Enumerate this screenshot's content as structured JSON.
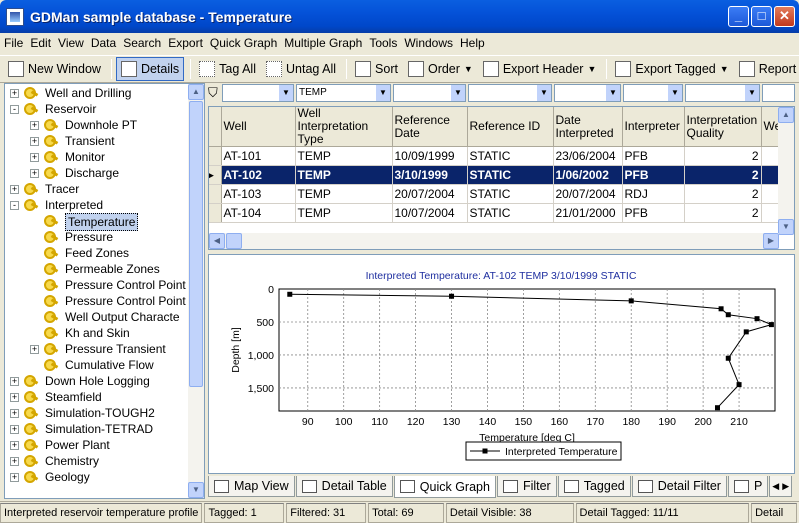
{
  "window": {
    "title": "GDMan sample database - Temperature"
  },
  "menu": [
    "File",
    "Edit",
    "View",
    "Data",
    "Search",
    "Export",
    "Quick Graph",
    "Multiple Graph",
    "Tools",
    "Windows",
    "Help"
  ],
  "toolbar": {
    "new_window": "New Window",
    "details": "Details",
    "tag_all": "Tag All",
    "untag_all": "Untag All",
    "sort": "Sort",
    "order": "Order",
    "export_header": "Export Header",
    "export_tagged": "Export Tagged",
    "report": "Report"
  },
  "tree": [
    {
      "label": "Well and Drilling",
      "level": 0,
      "exp": "+",
      "icon": true
    },
    {
      "label": "Reservoir",
      "level": 0,
      "exp": "-",
      "icon": true
    },
    {
      "label": "Downhole PT",
      "level": 1,
      "exp": "+",
      "icon": true
    },
    {
      "label": "Transient",
      "level": 1,
      "exp": "+",
      "icon": true
    },
    {
      "label": "Monitor",
      "level": 1,
      "exp": "+",
      "icon": true
    },
    {
      "label": "Discharge",
      "level": 1,
      "exp": "+",
      "icon": true
    },
    {
      "label": "Tracer",
      "level": 0,
      "exp": "+",
      "icon": true
    },
    {
      "label": "Interpreted",
      "level": 0,
      "exp": "-",
      "icon": true
    },
    {
      "label": "Temperature",
      "level": 1,
      "exp": "",
      "icon": true,
      "selected": true
    },
    {
      "label": "Pressure",
      "level": 1,
      "exp": "",
      "icon": true
    },
    {
      "label": "Feed Zones",
      "level": 1,
      "exp": "",
      "icon": true
    },
    {
      "label": "Permeable Zones",
      "level": 1,
      "exp": "",
      "icon": true
    },
    {
      "label": "Pressure Control Point",
      "level": 1,
      "exp": "",
      "icon": true
    },
    {
      "label": "Pressure Control Point",
      "level": 1,
      "exp": "",
      "icon": true
    },
    {
      "label": "Well Output Characte",
      "level": 1,
      "exp": "",
      "icon": true
    },
    {
      "label": "Kh and Skin",
      "level": 1,
      "exp": "",
      "icon": true
    },
    {
      "label": "Pressure Transient",
      "level": 1,
      "exp": "+",
      "icon": true
    },
    {
      "label": "Cumulative Flow",
      "level": 1,
      "exp": "",
      "icon": true
    },
    {
      "label": "Down Hole Logging",
      "level": 0,
      "exp": "+",
      "icon": true
    },
    {
      "label": "Steamfield",
      "level": 0,
      "exp": "+",
      "icon": true
    },
    {
      "label": "Simulation-TOUGH2",
      "level": 0,
      "exp": "+",
      "icon": true
    },
    {
      "label": "Simulation-TETRAD",
      "level": 0,
      "exp": "+",
      "icon": true
    },
    {
      "label": "Power Plant",
      "level": 0,
      "exp": "+",
      "icon": true
    },
    {
      "label": "Chemistry",
      "level": 0,
      "exp": "+",
      "icon": true
    },
    {
      "label": "Geology",
      "level": 0,
      "exp": "+",
      "icon": true
    }
  ],
  "filter": {
    "well_type_value": "TEMP"
  },
  "grid": {
    "columns": [
      "Well",
      "Well Interpretation Type",
      "Reference Date",
      "Reference ID",
      "Date Interpreted",
      "Interpreter",
      "Interpretation Quality",
      "We"
    ],
    "rows": [
      [
        "AT-101",
        "TEMP",
        "10/09/1999",
        "STATIC",
        "23/06/2004",
        "PFB",
        "2"
      ],
      [
        "AT-102",
        "TEMP",
        "3/10/1999",
        "STATIC",
        "1/06/2002",
        "PFB",
        "2"
      ],
      [
        "AT-103",
        "TEMP",
        "20/07/2004",
        "STATIC",
        "20/07/2004",
        "RDJ",
        "2"
      ],
      [
        "AT-104",
        "TEMP",
        "10/07/2004",
        "STATIC",
        "21/01/2000",
        "PFB",
        "2"
      ]
    ],
    "selected_row": 1
  },
  "chart_data": {
    "type": "line",
    "title": "Interpreted Temperature:   AT-102 TEMP 3/10/1999 STATIC",
    "xlabel": "Temperature [deg C]",
    "ylabel": "Depth [m]",
    "xlim": [
      82,
      220
    ],
    "ylim": [
      0,
      1850
    ],
    "xticks": [
      90,
      100,
      110,
      120,
      130,
      140,
      150,
      160,
      170,
      180,
      190,
      200,
      210
    ],
    "yticks": [
      0,
      500,
      1000,
      1500
    ],
    "ytick_labels": [
      "0",
      "500",
      "1,000",
      "1,500"
    ],
    "grid": true,
    "legend": "bottom",
    "series": [
      {
        "name": "Interpreted Temperature",
        "x": [
          85,
          130,
          180,
          205,
          207,
          215,
          219,
          212,
          207,
          210,
          204
        ],
        "y": [
          80,
          110,
          180,
          300,
          390,
          450,
          540,
          650,
          1050,
          1450,
          1800
        ]
      }
    ]
  },
  "tabs": [
    {
      "label": "Map View",
      "active": false
    },
    {
      "label": "Detail Table",
      "active": false
    },
    {
      "label": "Quick Graph",
      "active": true
    },
    {
      "label": "Filter",
      "active": false
    },
    {
      "label": "Tagged",
      "active": false
    },
    {
      "label": "Detail Filter",
      "active": false
    },
    {
      "label": "P",
      "active": false
    }
  ],
  "status": {
    "description": "Interpreted reservoir temperature profile",
    "tagged": "Tagged: 1",
    "filtered": "Filtered: 31",
    "total": "Total: 69",
    "detail_visible": "Detail Visible: 38",
    "detail_tagged": "Detail Tagged: 11/11",
    "detail": "Detail"
  },
  "colors": {
    "accent": "#0a246a",
    "title_blue": "#0451d8",
    "chart_title": "#1f2fa0"
  }
}
